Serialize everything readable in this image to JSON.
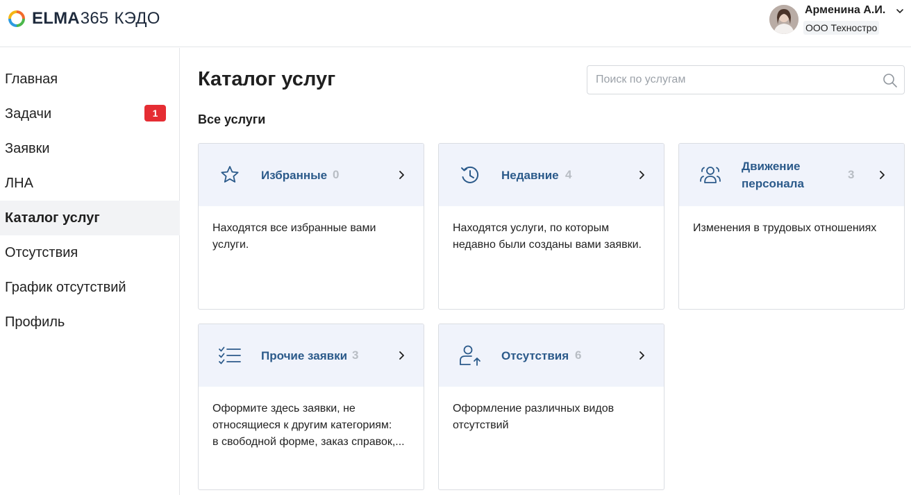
{
  "app": {
    "brand_bold": "ELMA",
    "brand_num": "365",
    "brand_product": "КЭДО",
    "colors": {
      "accent": "#2b5a8a",
      "badge": "#e52d33",
      "card_head": "#f0f3fb",
      "active_nav": "#f2f3f5"
    }
  },
  "user": {
    "name": "Арменина А.И.",
    "org": "ООО Техностро"
  },
  "sidebar": {
    "items": [
      {
        "label": "Главная"
      },
      {
        "label": "Задачи",
        "badge": "1"
      },
      {
        "label": "Заявки"
      },
      {
        "label": "ЛНА"
      },
      {
        "label": "Каталог услуг",
        "active": true
      },
      {
        "label": "Отсутствия"
      },
      {
        "label": "График отсутствий"
      },
      {
        "label": "Профиль"
      }
    ]
  },
  "main": {
    "title": "Каталог услуг",
    "search_placeholder": "Поиск по услугам",
    "section_title": "Все услуги",
    "cards": [
      {
        "title": "Избранные",
        "count": "0",
        "icon": "star-icon",
        "desc": [
          "Находятся все избранные вами",
          "услуги."
        ]
      },
      {
        "title": "Недавние",
        "count": "4",
        "icon": "history-icon",
        "desc": [
          "Находятся услуги, по которым",
          "недавно были созданы вами заявки."
        ]
      },
      {
        "title_lines": [
          "Движение",
          "персонала"
        ],
        "count": "3",
        "icon": "people-icon",
        "desc": [
          "Изменения в трудовых отношениях"
        ]
      },
      {
        "title": "Прочие заявки",
        "count": "3",
        "icon": "checklist-icon",
        "desc": [
          "Оформите здесь заявки, не",
          "относящиеся к другим категориям:",
          "в свободной форме, заказ справок,..."
        ]
      },
      {
        "title": "Отсутствия",
        "count": "6",
        "icon": "user-arrow-up-icon",
        "desc": [
          "Оформление различных видов",
          "отсутствий"
        ]
      }
    ]
  }
}
